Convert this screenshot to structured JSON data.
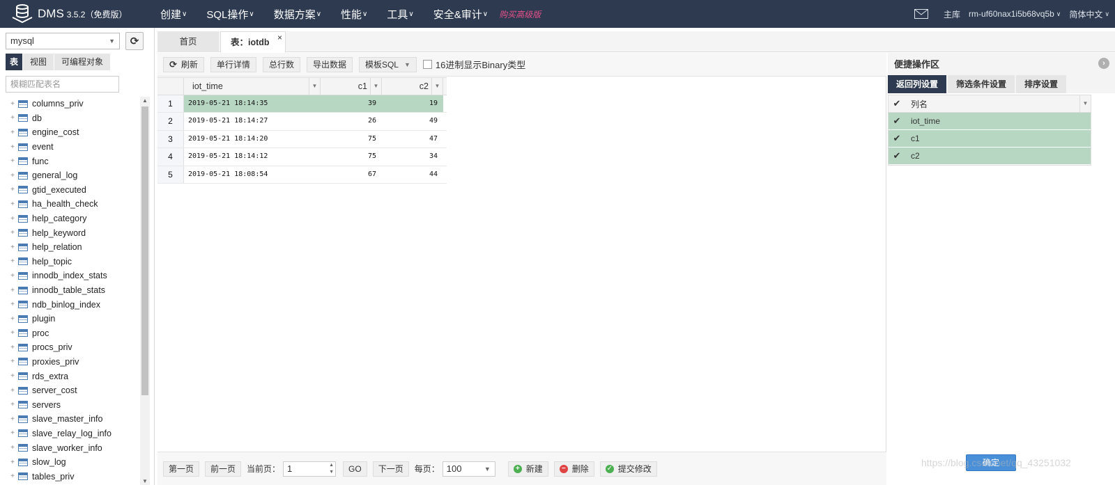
{
  "app": {
    "brand": "DMS",
    "version": "3.5.2（免费版）"
  },
  "nav": {
    "items": [
      "创建",
      "SQL操作",
      "数据方案",
      "性能",
      "工具",
      "安全&审计"
    ],
    "upgrade": "购买高级版"
  },
  "topright": {
    "instance_prefix": "主库",
    "instance": "rm-uf60nax1i5b68vq5b",
    "language": "简体中文"
  },
  "left": {
    "db_selected": "mysql",
    "tabs": [
      "表",
      "视图",
      "可编程对象"
    ],
    "filter_placeholder": "模糊匹配表名",
    "tables": [
      "columns_priv",
      "db",
      "engine_cost",
      "event",
      "func",
      "general_log",
      "gtid_executed",
      "ha_health_check",
      "help_category",
      "help_keyword",
      "help_relation",
      "help_topic",
      "innodb_index_stats",
      "innodb_table_stats",
      "ndb_binlog_index",
      "plugin",
      "proc",
      "procs_priv",
      "proxies_priv",
      "rds_extra",
      "server_cost",
      "servers",
      "slave_master_info",
      "slave_relay_log_info",
      "slave_worker_info",
      "slow_log",
      "tables_priv"
    ]
  },
  "doctabs": {
    "home": "首页",
    "active": "表：iotdb",
    "close": "×"
  },
  "toolbar": {
    "refresh": "刷新",
    "row_detail": "单行详情",
    "total_rows": "总行数",
    "export": "导出数据",
    "template_sql": "模板SQL",
    "hex_label": "16进制显示Binary类型"
  },
  "grid": {
    "columns": [
      "iot_time",
      "c1",
      "c2"
    ],
    "rows": [
      {
        "n": "1",
        "iot_time": "2019-05-21 18:14:35",
        "c1": "39",
        "c2": "19",
        "selected": true
      },
      {
        "n": "2",
        "iot_time": "2019-05-21 18:14:27",
        "c1": "26",
        "c2": "49",
        "selected": false
      },
      {
        "n": "3",
        "iot_time": "2019-05-21 18:14:20",
        "c1": "75",
        "c2": "47",
        "selected": false
      },
      {
        "n": "4",
        "iot_time": "2019-05-21 18:14:12",
        "c1": "75",
        "c2": "34",
        "selected": false
      },
      {
        "n": "5",
        "iot_time": "2019-05-21 18:08:54",
        "c1": "67",
        "c2": "44",
        "selected": false
      }
    ]
  },
  "pager": {
    "first": "第一页",
    "prev": "前一页",
    "current_label": "当前页：",
    "current": "1",
    "go": "GO",
    "next": "下一页",
    "per_page_label": "每页：",
    "per_page": "100",
    "new": "新建",
    "delete": "删除",
    "submit": "提交修改"
  },
  "rightpanel": {
    "title": "便捷操作区",
    "tabs": [
      "返回列设置",
      "筛选条件设置",
      "排序设置"
    ],
    "header": "列名",
    "columns": [
      "iot_time",
      "c1",
      "c2"
    ],
    "confirm": "确定"
  },
  "watermark": "https://blog.csdn.net/qq_43251032",
  "colors": {
    "nav_bg": "#2d3a4f",
    "selected_row": "#b8d7c3",
    "upgrade": "#e8508a",
    "primary_btn": "#4a90d9"
  }
}
